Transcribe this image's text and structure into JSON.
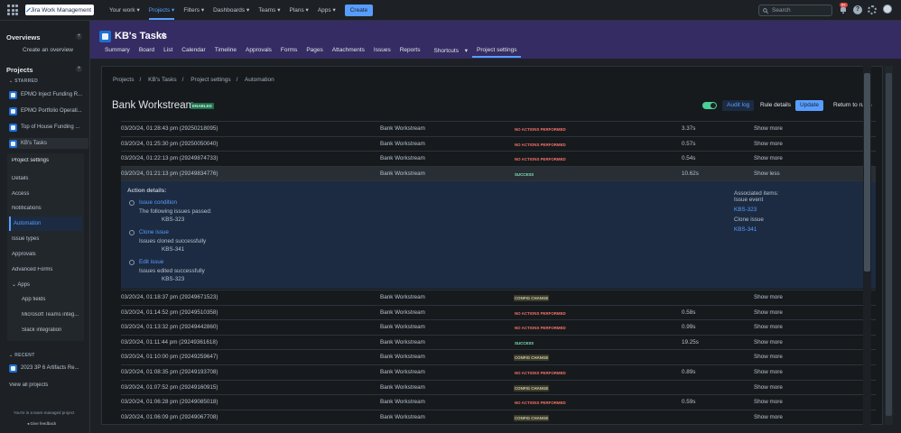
{
  "topbar": {
    "logo_text": "Jira Work Management",
    "nav": [
      "Your work",
      "Projects",
      "Filters",
      "Dashboards",
      "Teams",
      "Plans",
      "Apps"
    ],
    "create_label": "Create",
    "search_placeholder": "Search",
    "notification_count": "9+"
  },
  "sidebar": {
    "overviews_heading": "Overviews",
    "create_overview": "Create an overview",
    "projects_heading": "Projects",
    "starred_label": "STARRED",
    "starred_projects": [
      "EPMO Inject Funding R...",
      "EPMO Portfolio Operati...",
      "Top of House Funding ...",
      "KB's Tasks"
    ],
    "panel_header": "Project settings",
    "panel_items": [
      "Details",
      "Access",
      "Notifications",
      "Automation",
      "Issue types",
      "Approvals",
      "Advanced Forms",
      "Apps",
      "App fields",
      "Microsoft Teams integ...",
      "Slack integration"
    ],
    "recent_label": "RECENT",
    "recent_projects": [
      "2023 3P 6 Artifacts Re..."
    ],
    "view_all": "View all projects",
    "team_managed": "You're in a team-managed project",
    "feedback": "Give feedback"
  },
  "header": {
    "project_title": "KB's Tasks",
    "tabs": [
      "Summary",
      "Board",
      "List",
      "Calendar",
      "Timeline",
      "Approvals",
      "Forms",
      "Pages",
      "Attachments",
      "Issues",
      "Reports",
      "Shortcuts",
      "Project settings"
    ]
  },
  "main": {
    "breadcrumbs": [
      "Projects",
      "/",
      "KB's Tasks",
      "/",
      "Project settings",
      "/",
      "Automation"
    ],
    "rule_title": "Bank Workstream",
    "enabled_badge": "ENABLED",
    "buttons": {
      "audit_log": "Audit log",
      "rule_details": "Rule details",
      "update": "Update",
      "return": "Return to rules"
    },
    "rows_top": [
      {
        "date": "03/20/24, 01:28:43 pm  (29250218095)",
        "rule": "Bank Workstream",
        "status": "NO ACTIONS PERFORMED",
        "kind": "no",
        "duration": "3.37s",
        "action": "Show more"
      },
      {
        "date": "03/20/24, 01:25:30 pm  (29250050040)",
        "rule": "Bank Workstream",
        "status": "NO ACTIONS PERFORMED",
        "kind": "no",
        "duration": "0.57s",
        "action": "Show more"
      },
      {
        "date": "03/20/24, 01:22:13 pm  (29249874733)",
        "rule": "Bank Workstream",
        "status": "NO ACTIONS PERFORMED",
        "kind": "no",
        "duration": "0.54s",
        "action": "Show more"
      },
      {
        "date": "03/20/24, 01:21:13 pm  (29249834776)",
        "rule": "Bank Workstream",
        "status": "SUCCESS",
        "kind": "success",
        "duration": "10.62s",
        "action": "Show less"
      }
    ],
    "details": {
      "heading": "Action details:",
      "condition_title": "Issue condition",
      "condition_text": "The following issues passed:",
      "condition_issue": "KBS-323",
      "clone_title": "Clone issue",
      "clone_text": "Issues cloned successfully",
      "clone_issue": "KBS-341",
      "edit_title": "Edit issue",
      "edit_text": "Issues edited successfully",
      "edit_issue": "KBS-323",
      "assoc_heading": "Associated items:",
      "assoc_event": "Issue event",
      "assoc_event_issue": "KBS-323",
      "assoc_clone": "Clone issue",
      "assoc_clone_issue": "KBS-341"
    },
    "rows_bottom": [
      {
        "date": "03/20/24, 01:18:37 pm  (29249671523)",
        "rule": "Bank Workstream",
        "status": "CONFIG CHANGE",
        "kind": "config",
        "duration": "",
        "action": "Show more"
      },
      {
        "date": "03/20/24, 01:14:52 pm  (29249510358)",
        "rule": "Bank Workstream",
        "status": "NO ACTIONS PERFORMED",
        "kind": "no",
        "duration": "0.58s",
        "action": "Show more"
      },
      {
        "date": "03/20/24, 01:13:32 pm  (29249442860)",
        "rule": "Bank Workstream",
        "status": "NO ACTIONS PERFORMED",
        "kind": "no",
        "duration": "0.99s",
        "action": "Show more"
      },
      {
        "date": "03/20/24, 01:11:44 pm  (29249361618)",
        "rule": "Bank Workstream",
        "status": "SUCCESS",
        "kind": "success",
        "duration": "19.25s",
        "action": "Show more"
      },
      {
        "date": "03/20/24, 01:10:00 pm  (29249259647)",
        "rule": "Bank Workstream",
        "status": "CONFIG CHANGE",
        "kind": "config",
        "duration": "",
        "action": "Show more"
      },
      {
        "date": "03/20/24, 01:08:35 pm  (29249193708)",
        "rule": "Bank Workstream",
        "status": "NO ACTIONS PERFORMED",
        "kind": "no",
        "duration": "0.89s",
        "action": "Show more"
      },
      {
        "date": "03/20/24, 01:07:52 pm  (29249160915)",
        "rule": "Bank Workstream",
        "status": "CONFIG CHANGE",
        "kind": "config",
        "duration": "",
        "action": "Show more"
      },
      {
        "date": "03/20/24, 01:06:28 pm  (29249085018)",
        "rule": "Bank Workstream",
        "status": "NO ACTIONS PERFORMED",
        "kind": "no",
        "duration": "0.59s",
        "action": "Show more"
      },
      {
        "date": "03/20/24, 01:06:09 pm  (29249067708)",
        "rule": "Bank Workstream",
        "status": "CONFIG CHANGE",
        "kind": "config",
        "duration": "",
        "action": "Show more"
      }
    ]
  }
}
